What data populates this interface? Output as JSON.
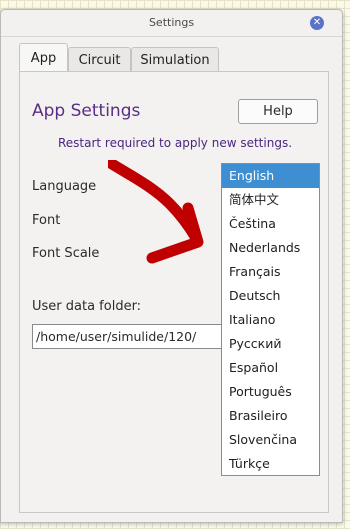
{
  "window": {
    "title": "Settings",
    "close_glyph": "✕"
  },
  "tabs": [
    {
      "label": "App",
      "active": true
    },
    {
      "label": "Circuit",
      "active": false
    },
    {
      "label": "Simulation",
      "active": false
    }
  ],
  "app_settings": {
    "heading": "App Settings",
    "help_label": "Help",
    "restart_notice": "Restart required to apply new settings.",
    "language_label": "Language",
    "font_label": "Font",
    "font_scale_label": "Font Scale",
    "user_folder_label": "User data folder:",
    "user_folder_value": "/home/user/simulide/120/"
  },
  "language_dropdown": {
    "selected": "English",
    "options": [
      "English",
      "简体中文",
      "Čeština",
      "Nederlands",
      "Français",
      "Deutsch",
      "Italiano",
      "Русский",
      "Español",
      "Português",
      "Brasileiro",
      "Slovenčina",
      "Türkçe"
    ]
  },
  "annotation": {
    "arrow_color": "#c00000"
  },
  "colors": {
    "accent": "#5a2d86",
    "selection": "#3d8fd1"
  }
}
